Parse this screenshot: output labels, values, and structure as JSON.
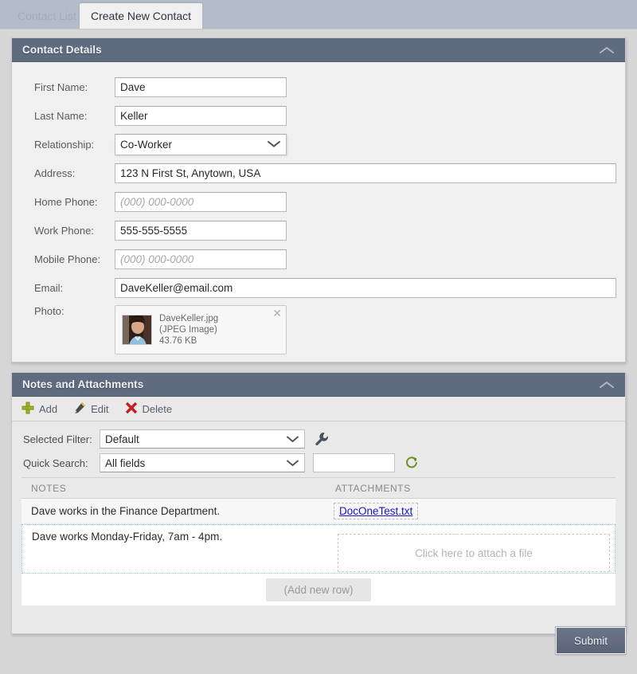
{
  "tabs": [
    {
      "label": "Contact List",
      "active": false
    },
    {
      "label": "Create New Contact",
      "active": true
    }
  ],
  "contact_panel": {
    "title": "Contact Details",
    "collapse_icon": "chevron-up-icon",
    "fields": {
      "first_name": {
        "label": "First Name:",
        "value": "Dave"
      },
      "last_name": {
        "label": "Last Name:",
        "value": "Keller"
      },
      "relationship": {
        "label": "Relationship:",
        "value": "Co-Worker"
      },
      "address": {
        "label": "Address:",
        "value": "123 N First St, Anytown, USA"
      },
      "home_phone": {
        "label": "Home Phone:",
        "value": "",
        "placeholder": "(000) 000-0000"
      },
      "work_phone": {
        "label": "Work Phone:",
        "value": "555-555-5555"
      },
      "mobile_phone": {
        "label": "Mobile Phone:",
        "value": "",
        "placeholder": "(000) 000-0000"
      },
      "email": {
        "label": "Email:",
        "value": "DaveKeller@email.com"
      },
      "photo": {
        "label": "Photo:",
        "file_name": "DaveKeller.jpg",
        "file_type": "(JPEG Image)",
        "file_size": "43.76 KB",
        "remove_icon": "close-icon"
      }
    }
  },
  "notes_panel": {
    "title": "Notes and Attachments",
    "collapse_icon": "chevron-up-icon",
    "toolbar": [
      {
        "label": "Add",
        "icon": "plus-icon",
        "color": "#8aa522"
      },
      {
        "label": "Edit",
        "icon": "pencil-icon",
        "color": "#4a4a4a"
      },
      {
        "label": "Delete",
        "icon": "x-icon",
        "color": "#c21f1f"
      }
    ],
    "filters": {
      "selected_filter_label": "Selected Filter:",
      "selected_filter_value": "Default",
      "settings_icon": "wrench-icon",
      "quick_search_label": "Quick Search:",
      "quick_search_value": "All fields",
      "quick_search_input": "",
      "refresh_icon": "refresh-icon"
    },
    "grid": {
      "columns": [
        "NOTES",
        "ATTACHMENTS"
      ],
      "rows": [
        {
          "note": "Dave works in the Finance Department.",
          "attachment": "DocOneTest.txt",
          "selected": false
        },
        {
          "note": "Dave works Monday-Friday, 7am - 4pm.",
          "attachment_placeholder": "Click here to attach a file",
          "selected": true
        }
      ],
      "add_row_label": "(Add new row)"
    }
  },
  "submit": {
    "label": "Submit"
  },
  "colors": {
    "panel_header": "#5f6b7e",
    "page_background": "#d6d6d6",
    "tabstrip_background": "#b5bcc9",
    "accent_link": "#1414cf",
    "selection_border": "#8fc4dd"
  }
}
